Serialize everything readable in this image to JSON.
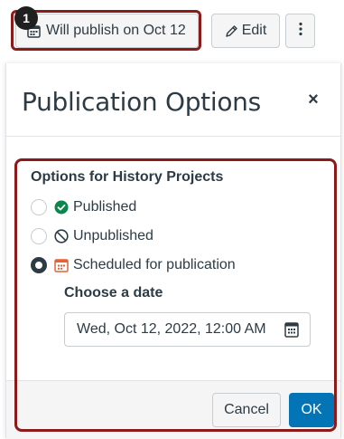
{
  "toolbar": {
    "publish_status_label": "Will publish on Oct 12",
    "edit_label": "Edit",
    "step_number": "1"
  },
  "dialog": {
    "title": "Publication Options",
    "close_glyph": "×",
    "options_title": "Options for History Projects",
    "options": [
      {
        "label": "Published",
        "icon": "check-circle-icon",
        "selected": false
      },
      {
        "label": "Unpublished",
        "icon": "no-entry-icon",
        "selected": false
      },
      {
        "label": "Scheduled for publication",
        "icon": "calendar-icon",
        "selected": true
      }
    ],
    "choose_date_label": "Choose a date",
    "date_value": "Wed, Oct 12, 2022, 12:00 AM",
    "cancel_label": "Cancel",
    "ok_label": "OK"
  },
  "colors": {
    "highlight": "#8b1a1a",
    "primary": "#0374b5",
    "success": "#0b874b",
    "scheduled": "#e66135",
    "text": "#2d3b45"
  }
}
